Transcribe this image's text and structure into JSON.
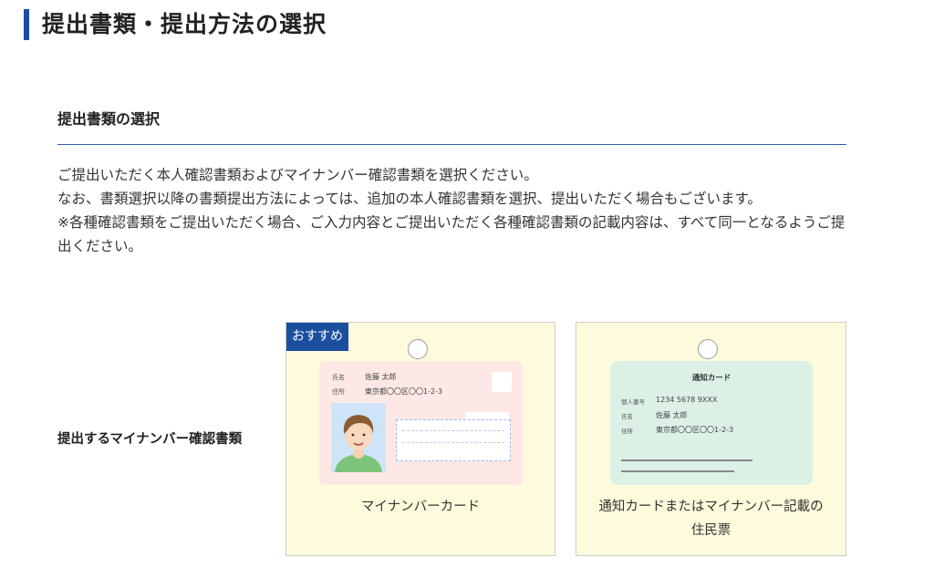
{
  "page": {
    "title": "提出書類・提出方法の選択"
  },
  "section": {
    "title": "提出書類の選択",
    "intro": [
      "ご提出いただく本人確認書類およびマイナンバー確認書類を選択ください。",
      "なお、書類選択以降の書類提出方法によっては、追加の本人確認書類を選択、提出いただく場合もございます。",
      "※各種確認書類をご提出いただく場合、ご入力内容とご提出いただく各種確認書類の記載内容は、すべて同一となるようご提出ください。"
    ]
  },
  "mynumber_doc": {
    "row_label": "提出するマイナンバー確認書類",
    "options": [
      {
        "badge": "おすすめ",
        "label": "マイナンバーカード",
        "selected": false,
        "card": {
          "name_label": "氏名",
          "name_value": "佐藤 太郎",
          "address_label": "住所",
          "address_value": "東京都〇〇区〇〇1-2-3"
        }
      },
      {
        "label_line1": "通知カードまたはマイナンバー記載の",
        "label_line2": "住民票",
        "selected": false,
        "card": {
          "title": "通知カード",
          "number_label": "個人番号",
          "number_value": "1234 5678 9XXX",
          "name_label": "氏名",
          "name_value": "佐藤 太郎",
          "address_label": "住所",
          "address_value": "東京都〇〇区〇〇1-2-3"
        }
      }
    ]
  },
  "colors": {
    "accent": "#1a4fa0",
    "card_bg": "#fefbdc",
    "mynumber_card_bg": "#fde8e6",
    "notice_card_bg": "#dcf0e6"
  }
}
